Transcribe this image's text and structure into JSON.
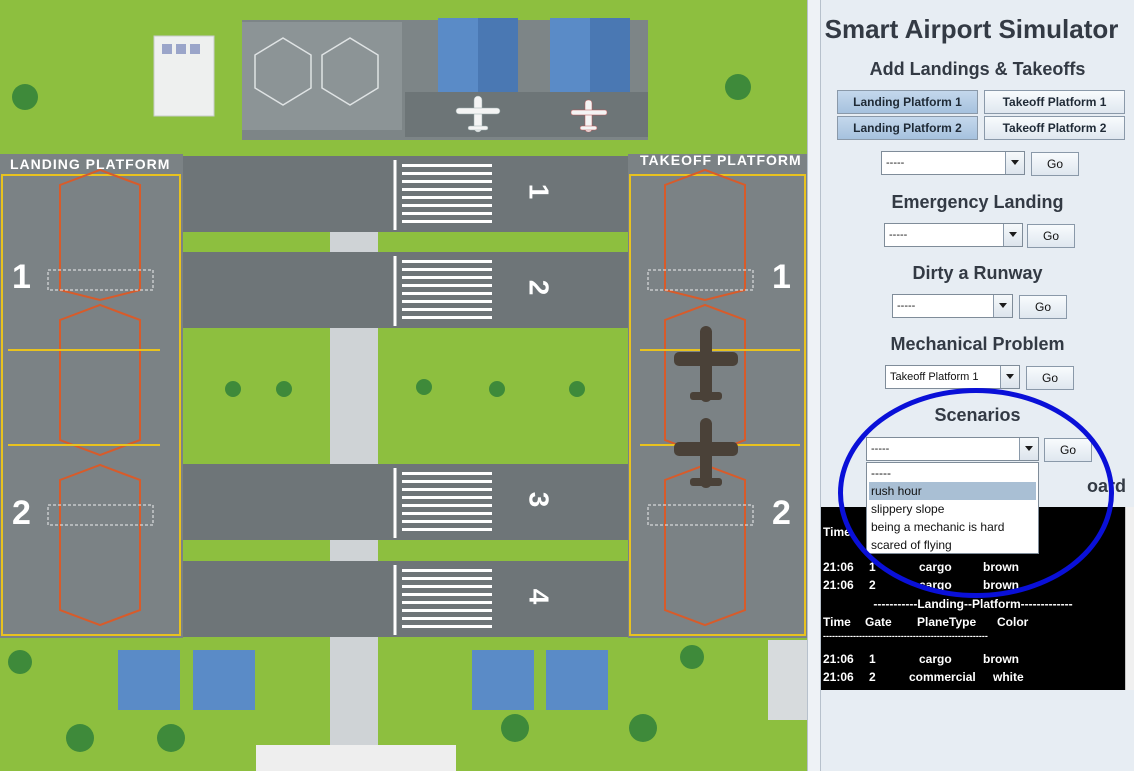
{
  "map": {
    "landing_platform_label": "LANDING PLATFORM",
    "takeoff_platform_label": "TAKEOFF PLATFORM",
    "landing_gate_numbers": [
      "1",
      "2"
    ],
    "takeoff_gate_numbers": [
      "1",
      "2"
    ],
    "runway_numbers": [
      "1",
      "2",
      "3",
      "4"
    ]
  },
  "panel": {
    "title": "Smart Airport Simulator",
    "add_section": {
      "heading": "Add Landings & Takeoffs",
      "buttons": [
        "Landing Platform 1",
        "Takeoff Platform 1",
        "Landing Platform 2",
        "Takeoff Platform 2"
      ],
      "selected_value": "-----",
      "go": "Go"
    },
    "emergency": {
      "heading": "Emergency Landing",
      "selected_value": "-----",
      "go": "Go"
    },
    "dirty": {
      "heading": "Dirty a Runway",
      "selected_value": "-----",
      "go": "Go"
    },
    "mechanical": {
      "heading": "Mechanical Problem",
      "selected_value": "Takeoff Platform 1",
      "go": "Go"
    },
    "scenarios": {
      "heading": "Scenarios",
      "selected_value": "-----",
      "go": "Go",
      "options": [
        "-----",
        "rush hour",
        "slippery slope",
        "being a mechanic is hard",
        "scared of flying"
      ],
      "highlighted": "rush hour"
    },
    "board": {
      "heading_visible": "oard",
      "top_header_partial": "Time",
      "takeoff_rows": [
        [
          "21:06",
          "1",
          "cargo",
          "brown"
        ],
        [
          "21:06",
          "2",
          "cargo",
          "brown"
        ]
      ],
      "landing_separator": "-----------Landing--Platform-------------",
      "columns": [
        "Time",
        "Gate",
        "PlaneType",
        "Color"
      ],
      "dash_line": "-------------------------------------------------------",
      "landing_rows": [
        [
          "21:06",
          "1",
          "cargo",
          "brown"
        ],
        [
          "21:06",
          "2",
          "commercial",
          "white"
        ]
      ]
    }
  }
}
